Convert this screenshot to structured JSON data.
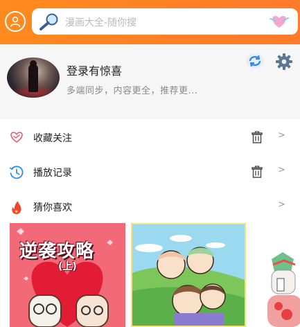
{
  "search": {
    "placeholder": "漫画大全-随你搜"
  },
  "user": {
    "title": "登录有惊喜",
    "subtitle": "多端同步，内容更全，推荐更..."
  },
  "menu": [
    {
      "label": "收藏关注",
      "chevron": ">"
    },
    {
      "label": "播放记录",
      "chevron": ">"
    },
    {
      "label": "猜你喜欢",
      "chevron": ">"
    }
  ],
  "recommendations": [
    {
      "cover_title": "逆袭攻略",
      "cover_subtitle": "(上)"
    }
  ],
  "colors": {
    "accent": "#ff8a1e",
    "panel_bg": "#f6f6f6",
    "icon_pink": "#e75d7a",
    "icon_blue": "#2d8cf0",
    "flame": "#f0462d"
  }
}
